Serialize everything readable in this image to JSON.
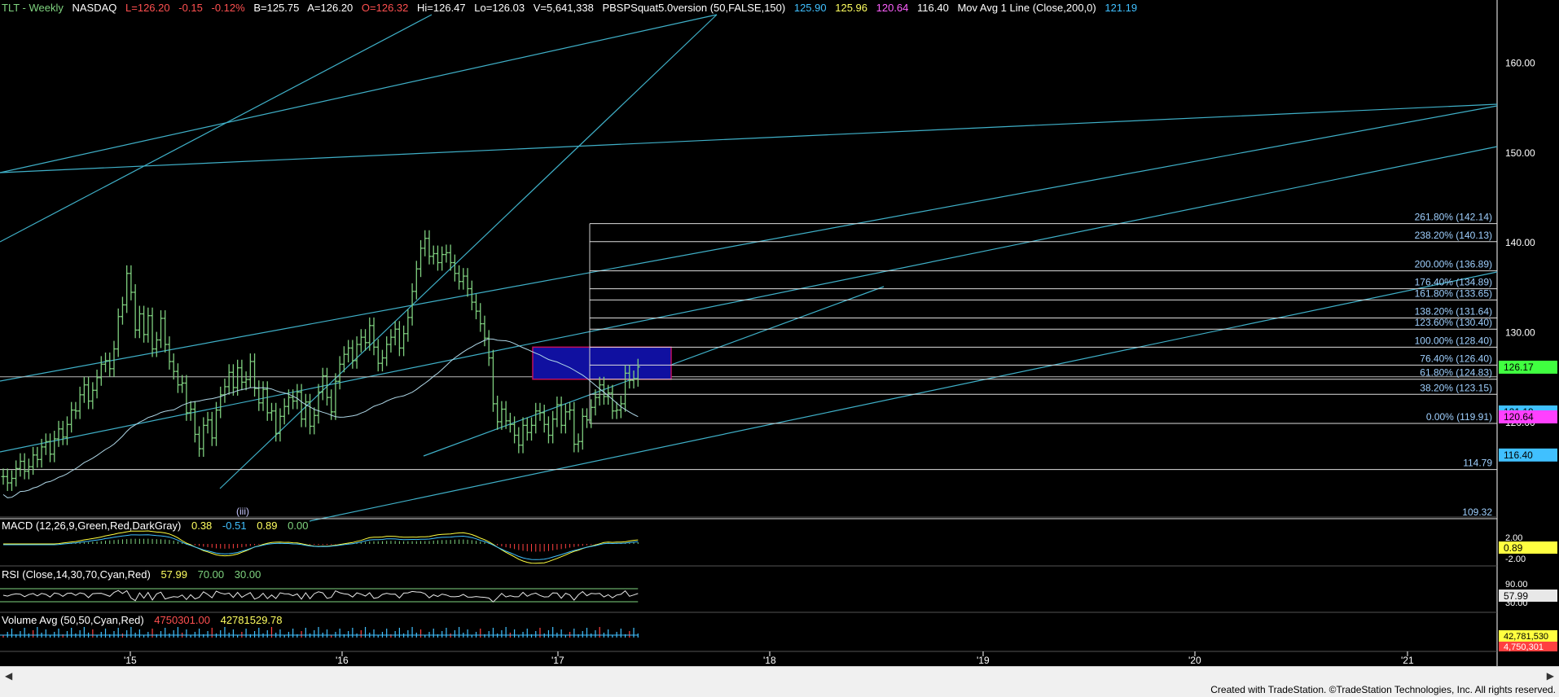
{
  "header": {
    "symbol": "TLT - Weekly",
    "exchange": "NASDAQ",
    "last": "L=126.20",
    "change": "-0.15",
    "change_pct": "-0.12%",
    "bid": "B=125.75",
    "ask": "A=126.20",
    "open": "O=126.32",
    "high": "Hi=126.47",
    "low": "Lo=126.03",
    "volume": "V=5,641,338",
    "study": "PBSPSquat5.0version (50,FALSE,150)",
    "v1": "125.90",
    "v2": "125.96",
    "v3": "120.64",
    "v4": "116.40",
    "ma_label": "Mov Avg 1 Line (Close,200,0)",
    "ma_value": "121.19"
  },
  "macd": {
    "label": "MACD (12,26,9,Green,Red,DarkGray)",
    "v1": "0.38",
    "v2": "-0.51",
    "v3": "0.89",
    "v4": "0.00",
    "axis": [
      "2.00",
      "-2.00"
    ],
    "badge": "0.89"
  },
  "rsi": {
    "label": "RSI (Close,14,30,70,Cyan,Red)",
    "v1": "57.99",
    "v2": "70.00",
    "v3": "30.00",
    "axis": [
      "90.00",
      "30.00"
    ],
    "badge": "57.99"
  },
  "volume": {
    "label": "Volume Avg (50,50,Cyan,Red)",
    "v1": "4750301.00",
    "v2": "42781529.78",
    "badge1": "42,781,530",
    "badge2": "4,750,301"
  },
  "footer": "Created with TradeStation. ©TradeStation Technologies, Inc. All rights reserved.",
  "colors": {
    "bars": "#7fcf7f",
    "trend": "#3fb0c8",
    "fib": "#ffffff",
    "box": "#1010a0",
    "boxEdge": "#c01060",
    "up": "#7fd37f",
    "down": "#ff4040",
    "yellow": "#ffff40",
    "magenta": "#ff40ff"
  },
  "chart_data": {
    "type": "candlestick",
    "y_ticks": [
      160,
      150,
      140,
      130,
      120
    ],
    "y_tick_labels": [
      "160.00",
      "150.00",
      "140.00",
      "130.00",
      "120.00"
    ],
    "x_labels": [
      "'15",
      "'16",
      "'17",
      "'18",
      "'19",
      "'20",
      "'21"
    ],
    "wave_label": "(iii)",
    "fib_levels": [
      {
        "label": "261.80% (142.14)",
        "value": 142.14
      },
      {
        "label": "238.20% (140.13)",
        "value": 140.13
      },
      {
        "label": "200.00% (136.89)",
        "value": 136.89
      },
      {
        "label": "176.40% (134.89)",
        "value": 134.89
      },
      {
        "label": "161.80% (133.65)",
        "value": 133.65
      },
      {
        "label": "138.20% (131.64)",
        "value": 131.64
      },
      {
        "label": "123.60% (130.40)",
        "value": 130.4
      },
      {
        "label": "100.00% (128.40)",
        "value": 128.4
      },
      {
        "label": "76.40% (126.40)",
        "value": 126.4
      },
      {
        "label": "61.80% (124.83)",
        "value": 124.83
      },
      {
        "label": "38.20% (123.15)",
        "value": 123.15
      },
      {
        "label": "0.00% (119.91)",
        "value": 119.91
      }
    ],
    "hlines": [
      {
        "label": "114.79",
        "value": 114.79
      },
      {
        "label": "109.32",
        "value": 109.32
      }
    ],
    "price_badges": [
      {
        "label": "126.17",
        "value": 126.17,
        "color": "#40ff40",
        "text": "#000"
      },
      {
        "label": "121.19",
        "value": 121.19,
        "color": "#40c0ff",
        "text": "#000"
      },
      {
        "label": "120.64",
        "value": 120.64,
        "color": "#ff40ff",
        "text": "#000"
      },
      {
        "label": "116.40",
        "value": 116.4,
        "color": "#40c0ff",
        "text": "#000"
      }
    ],
    "closes": [
      114.0,
      113.3,
      113.8,
      114.9,
      115.7,
      114.6,
      115.1,
      116.4,
      115.9,
      117.3,
      117.9,
      116.5,
      118.2,
      119.3,
      118.4,
      119.8,
      121.4,
      121.3,
      123.1,
      124.2,
      122.4,
      123.6,
      125.0,
      126.5,
      126.9,
      126.0,
      128.2,
      131.8,
      133.1,
      136.6,
      134.5,
      130.3,
      132.1,
      129.8,
      131.9,
      128.2,
      129.2,
      131.6,
      128.7,
      126.8,
      125.7,
      124.2,
      124.4,
      121.1,
      121.5,
      118.7,
      117.1,
      119.7,
      120.3,
      118.3,
      121.4,
      123.1,
      124.0,
      125.6,
      123.9,
      126.1,
      124.5,
      124.8,
      126.8,
      123.8,
      122.2,
      123.7,
      121.1,
      121.3,
      118.8,
      120.7,
      121.8,
      122.8,
      122.4,
      123.4,
      120.4,
      122.3,
      119.6,
      120.8,
      123.4,
      125.2,
      122.8,
      121.2,
      124.6,
      126.5,
      127.6,
      128.3,
      126.9,
      128.7,
      129.5,
      128.9,
      130.8,
      128.4,
      126.6,
      127.2,
      128.7,
      129.5,
      130.4,
      128.3,
      129.9,
      131.7,
      134.6,
      137.1,
      139.4,
      140.5,
      138.5,
      138.8,
      137.8,
      138.7,
      138.9,
      137.8,
      136.6,
      135.7,
      136.3,
      134.9,
      133.4,
      132.4,
      131.0,
      129.4,
      127.2,
      122.1,
      120.1,
      121.5,
      120.2,
      119.8,
      118.6,
      117.5,
      119.7,
      118.9,
      119.7,
      121.3,
      121.1,
      119.8,
      118.6,
      120.4,
      122.0,
      119.7,
      121.2,
      121.4,
      117.6,
      117.9,
      120.7,
      120.3,
      121.7,
      122.8,
      124.2,
      122.9,
      123.3,
      121.3,
      121.4,
      122.1,
      125.5,
      124.7,
      124.9,
      126.2
    ]
  }
}
